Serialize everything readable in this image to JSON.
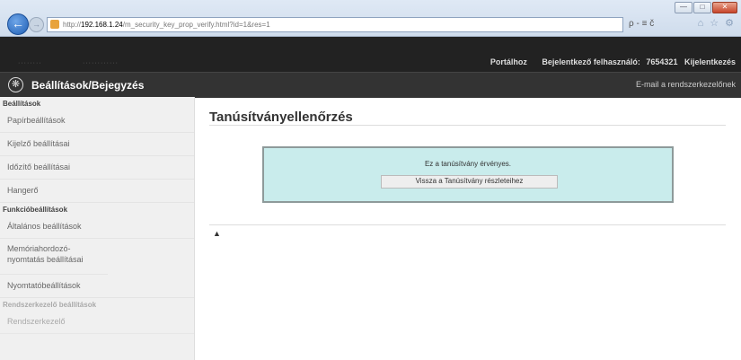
{
  "browser": {
    "url_host": "192.168.1.24",
    "url_prefix": "http://",
    "url_path": "/m_security_key_prop_verify.html?id=1&res=1",
    "addr_tools": "ρ - ≡ č",
    "window_buttons": [
      "—",
      "□",
      "✕"
    ],
    "toolbar_icons": [
      "home-icon",
      "star-icon",
      "gear-icon"
    ]
  },
  "header": {
    "links": [
      "Portálhoz",
      "Bejelentkező felhasználó:",
      "7654321",
      "Kijelentkezés"
    ],
    "blur_left": "········",
    "blur_mid": "············"
  },
  "app": {
    "title": "Beállítások/Bejegyzés",
    "mail_link": "E-mail a rendszerkezelőnek"
  },
  "sidebar": {
    "section1": "Beállítások",
    "items1": [
      "Papírbeállítások",
      "Kijelző beállításai",
      "Időzítő beállításai",
      "Hangerő"
    ],
    "section2": "Funkcióbeállítások",
    "items2": [
      "Általános beállítások",
      "Memóriahordozó-nyomtatás beállításai",
      "Nyomtatóbeállítások"
    ],
    "section3": "Rendszerkezelő beállítások",
    "item3": "Rendszerkezelő"
  },
  "main": {
    "title": "Tanúsítványellenőrzés",
    "message": "Ez a tanúsítvány érvényes.",
    "back_button": "Vissza a Tanúsítvány részleteihez",
    "to_top": "▲"
  }
}
